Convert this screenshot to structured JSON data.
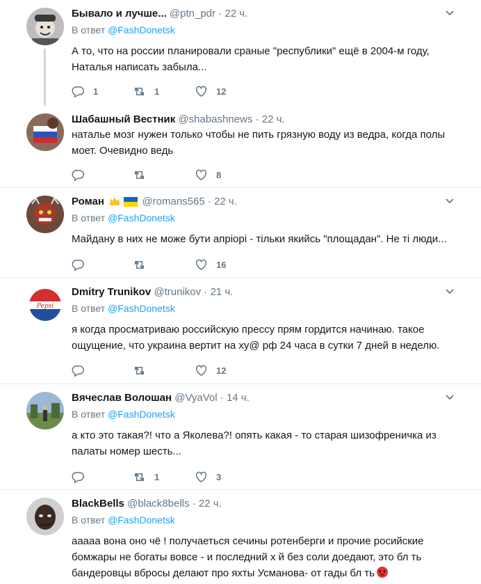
{
  "tweets": [
    {
      "name": "Бывало и лучше...",
      "handle": "@ptn_pdr",
      "time": "22 ч.",
      "reply_prefix": "В ответ",
      "reply_to": "@FashDonetsk",
      "text_lines": [
        "А то, что на россии планировали сраные \"республики\" ещё в 2004-м году,",
        "Наталья написать забыла..."
      ],
      "replies": "1",
      "retweets": "1",
      "likes": "12"
    },
    {
      "name": "Шабашный Вестник",
      "handle": "@shabashnews",
      "time": "22 ч.",
      "text_lines": [
        "натальe мозг нужен только чтобы не пить грязную воду из ведра, когда полы",
        "моет. Очевидно ведь"
      ],
      "replies": "",
      "retweets": "",
      "likes": "8"
    },
    {
      "name": "Роман",
      "handle": "@romans565",
      "time": "22 ч.",
      "reply_prefix": "В ответ",
      "reply_to": "@FashDonetsk",
      "text_lines": [
        "Майдану в них не може бути апріорі - тільки якийсь \"площадан\". Не ті люди..."
      ],
      "replies": "",
      "retweets": "",
      "likes": "16"
    },
    {
      "name": "Dmitry Trunikov",
      "handle": "@trunikov",
      "time": "21 ч.",
      "reply_prefix": "В ответ",
      "reply_to": "@FashDonetsk",
      "text_lines": [
        "я когда просматриваю российскую прессу прям гордится начинаю. такое",
        "ощущение, что украина вертит на ху@ рф 24 часа в сутки 7 дней в неделю."
      ],
      "replies": "",
      "retweets": "",
      "likes": "12"
    },
    {
      "name": "Вячеслав Волошан",
      "handle": "@VyaVol",
      "time": "14 ч.",
      "reply_prefix": "В ответ",
      "reply_to": "@FashDonetsk",
      "text_lines": [
        "а кто это такая?! что а Яколева?! опять какая - то старая шизофреничка из",
        "палаты номер шесть..."
      ],
      "replies": "",
      "retweets": "1",
      "likes": "3"
    },
    {
      "name": "BlackBells",
      "handle": "@black8bells",
      "time": "22 ч.",
      "reply_prefix": "В ответ",
      "reply_to": "@FashDonetsk",
      "text_lines": [
        "ааааа вона оно чё ! получаеться сечины ротенберги и прочие росийские",
        "бомжары не богаты вовсе - и последний х  й без соли доедают, это бл  ть",
        "бандеровцы вбросы делают про яхты Усманова- от гады бл  ть"
      ]
    }
  ],
  "colors": {
    "link": "#1da1f2",
    "muted": "#657786",
    "text": "#14171a",
    "divider": "#e6ecf0",
    "thread": "#ccd6dd"
  },
  "icons": [
    "reply-icon",
    "retweet-icon",
    "like-icon",
    "caret-down-icon",
    "crown-icon",
    "ukraine-flag-icon",
    "angry-emoji-icon"
  ]
}
